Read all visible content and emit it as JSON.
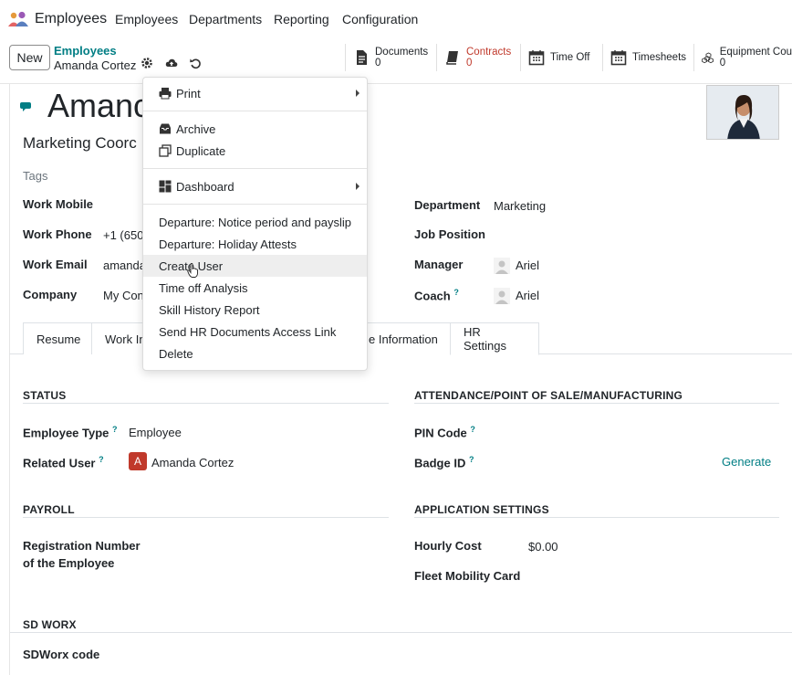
{
  "navbar": {
    "app_name": "Employees",
    "menu": [
      "Employees",
      "Departments",
      "Reporting",
      "Configuration"
    ]
  },
  "control_panel": {
    "new_label": "New",
    "breadcrumb_parent": "Employees",
    "breadcrumb_current": "Amanda Cortez",
    "smart_buttons": [
      {
        "label": "Documents",
        "count": "0",
        "icon": "file-icon"
      },
      {
        "label": "Contracts",
        "count": "0",
        "icon": "book-icon"
      },
      {
        "label": "Time Off",
        "icon": "calendar-icon"
      },
      {
        "label": "Timesheets",
        "icon": "calendar-icon"
      },
      {
        "label": "Equipment Cou",
        "count": "0",
        "icon": "cubes-icon"
      }
    ]
  },
  "employee": {
    "name": "Amanda Cortez",
    "name_visible": "Amanc",
    "job_title_visible": "Marketing Coorc",
    "tags_placeholder": "Tags"
  },
  "fields_left": [
    {
      "label": "Work Mobile",
      "value": ""
    },
    {
      "label": "Work Phone",
      "value": "+1 (650"
    },
    {
      "label": "Work Email",
      "value": "amanda"
    },
    {
      "label": "Company",
      "value": "My Con"
    }
  ],
  "fields_right": [
    {
      "label": "Department",
      "value": "Marketing",
      "help": false
    },
    {
      "label": "Job Position",
      "value": "",
      "help": false
    },
    {
      "label": "Manager",
      "value": "Ariel",
      "help": false
    },
    {
      "label": "Coach",
      "value": "Ariel",
      "help": true
    }
  ],
  "tabs": [
    {
      "label": "Resume",
      "active": false
    },
    {
      "label": "Work In",
      "active": false
    },
    {
      "label": "e Information",
      "active": false
    },
    {
      "label": "HR Settings",
      "active": true
    }
  ],
  "hr_settings": {
    "status_title": "STATUS",
    "employee_type_label": "Employee Type",
    "employee_type_value": "Employee",
    "related_user_label": "Related User",
    "related_user_initial": "A",
    "related_user_value": "Amanda Cortez",
    "attendance_title": "ATTENDANCE/POINT OF SALE/MANUFACTURING",
    "pin_label": "PIN Code",
    "badge_label": "Badge ID",
    "generate_label": "Generate",
    "payroll_title": "PAYROLL",
    "registration_label_1": "Registration Number",
    "registration_label_2": "of the Employee",
    "application_title": "APPLICATION SETTINGS",
    "hourly_cost_label": "Hourly Cost",
    "hourly_cost_value": "$0.00",
    "fleet_label": "Fleet Mobility Card",
    "sdworx_title": "SD WORX",
    "sdworx_label": "SDWorx code"
  },
  "dropdown": {
    "print": "Print",
    "archive": "Archive",
    "duplicate": "Duplicate",
    "dashboard": "Dashboard",
    "items": [
      "Departure: Notice period and payslip",
      "Departure: Holiday Attests",
      "Create User",
      "Time off Analysis",
      "Skill History Report",
      "Send HR Documents Access Link",
      "Delete"
    ],
    "hovered": "Create User"
  },
  "colors": {
    "accent": "#017e84",
    "contracts": "#c0392b",
    "badge": "#c0392b"
  }
}
